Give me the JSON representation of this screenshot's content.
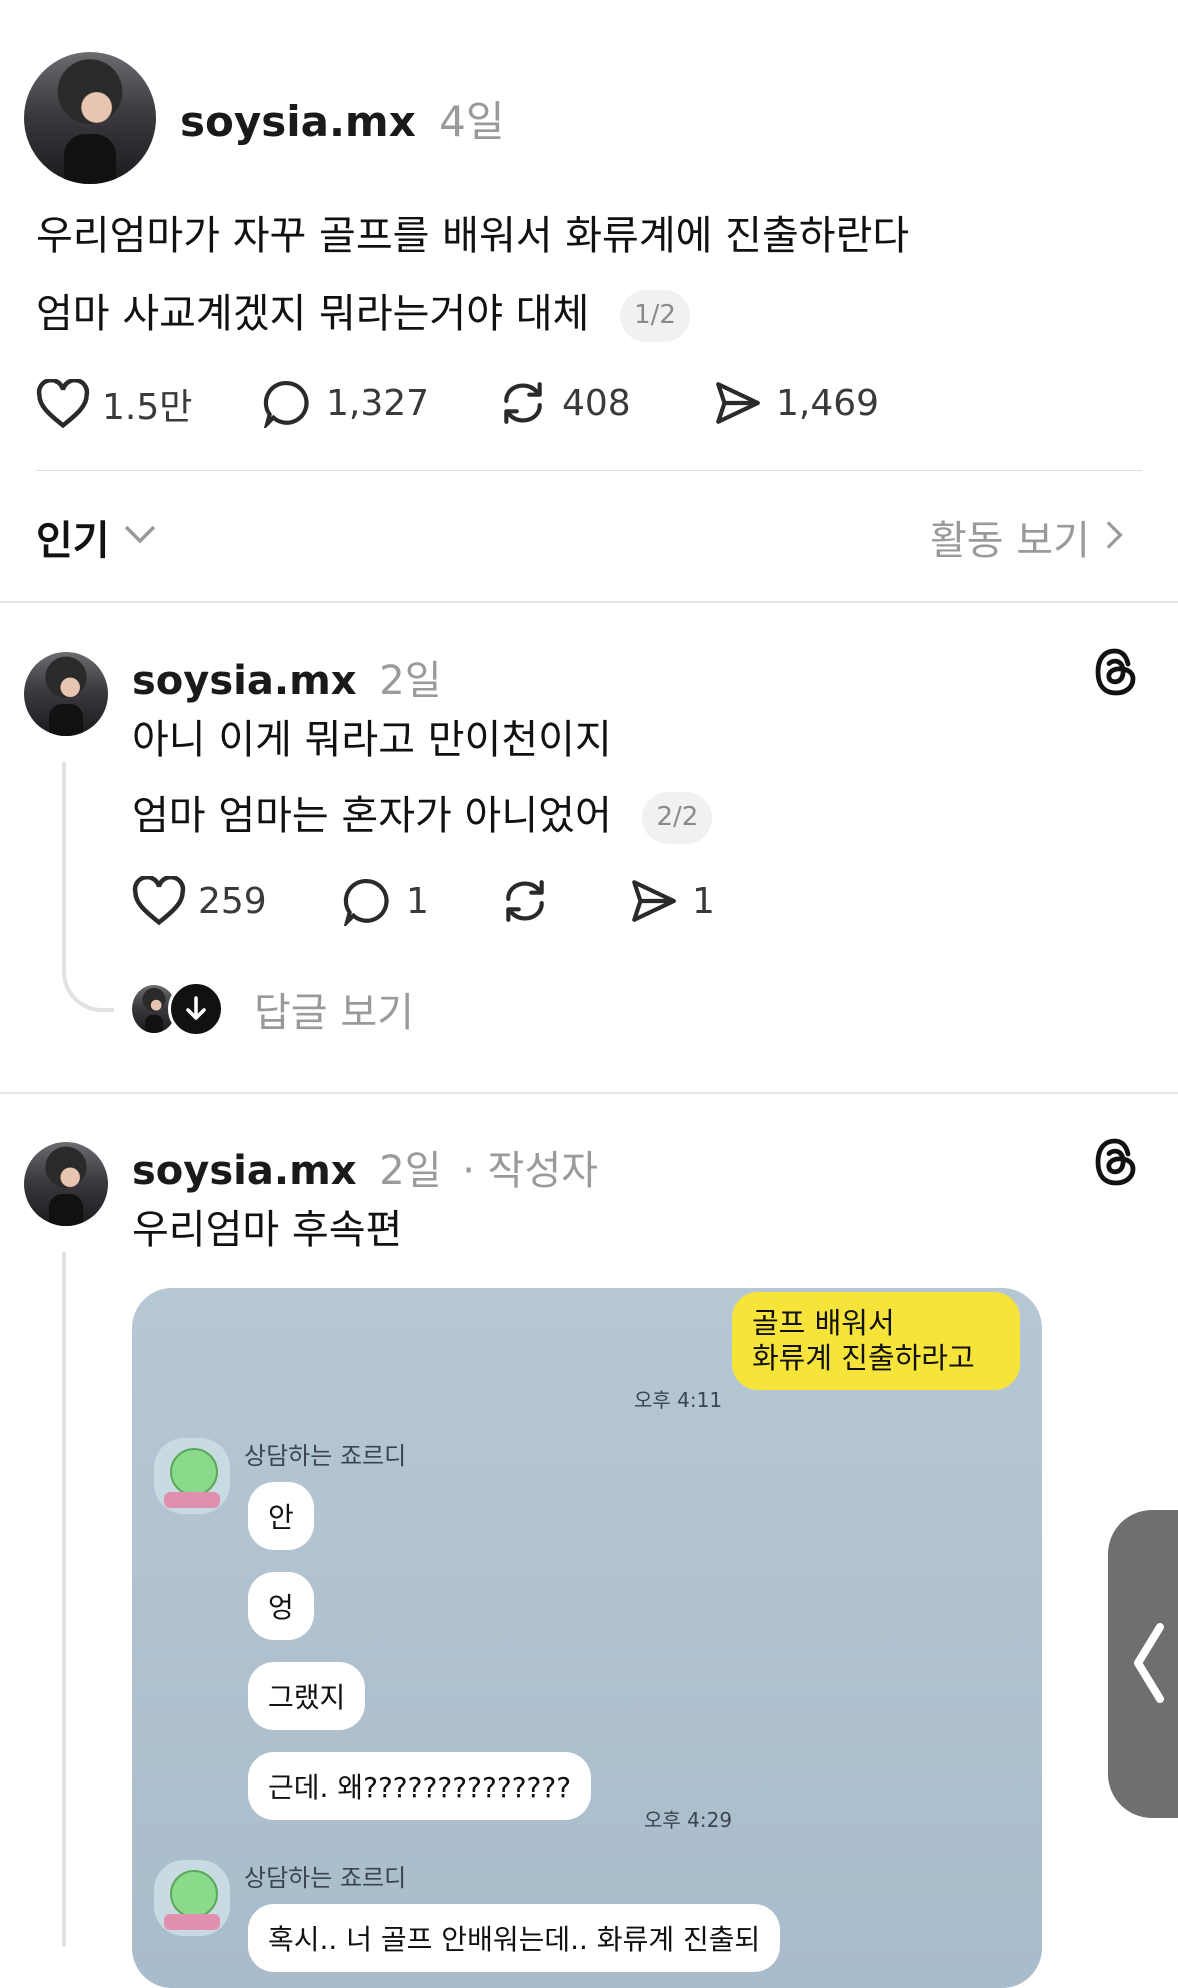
{
  "post": {
    "username": "soysia.mx",
    "time": "4일",
    "line1": "우리엄마가 자꾸 골프를 배워서 화류계에 진출하란다",
    "line2": "엄마 사교계겠지 뭐라는거야 대체",
    "page": "1/2",
    "likes": "1.5만",
    "comments": "1,327",
    "reposts": "408",
    "shares": "1,469"
  },
  "sort": {
    "label": "인기",
    "activity": "활동 보기"
  },
  "reply1": {
    "username": "soysia.mx",
    "time": "2일",
    "line1": "아니 이게 뭐라고 만이천이지",
    "line2": "엄마 엄마는 혼자가 아니었어",
    "page": "2/2",
    "likes": "259",
    "comments": "1",
    "shares": "1",
    "view_replies": "답글 보기"
  },
  "reply2": {
    "username": "soysia.mx",
    "time": "2일",
    "author_tag": "· 작성자",
    "text": "우리엄마 후속편",
    "chat": {
      "my_msg_line1": "골프 배워서",
      "my_msg_line2": "화류계 진출하라고",
      "my_time": "오후 4:11",
      "bot_name": "상담하는 죠르디",
      "bot_msgs": [
        "안",
        "엉",
        "그랬지",
        "근데. 왜??????????????"
      ],
      "bot_time": "오후 4:29",
      "bot_name2": "상담하는 죠르디",
      "bot_msg_partial": "혹시.. 너 골프 안배워는데.. 화류계 진출되"
    }
  },
  "icons": {
    "threads": "threads-logo-icon",
    "heart": "heart-icon",
    "comment": "comment-icon",
    "repost": "repost-icon",
    "share": "send-icon",
    "chevron_down": "chevron-down-icon",
    "chevron_right": "chevron-right-icon",
    "side_tab": "chevron-left-icon"
  },
  "colors": {
    "chat_bg": "#aabdcb",
    "my_bubble": "#f7e43b",
    "muted_text": "#9a9a9a"
  }
}
